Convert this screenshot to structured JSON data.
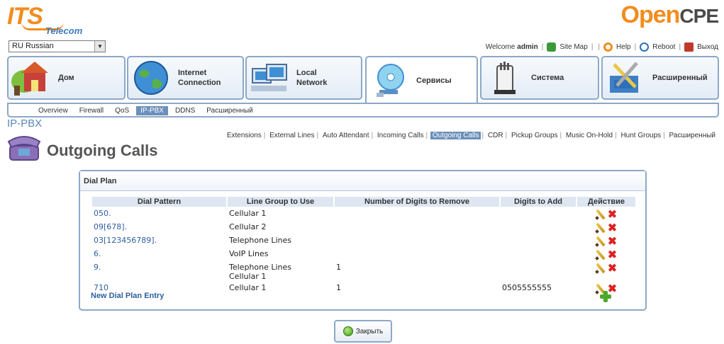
{
  "header": {
    "brand_left_main": "ITS",
    "brand_left_sub": "Telecom",
    "brand_right_open": "Open",
    "brand_right_cpe": "CPE",
    "language": "RU Russian",
    "welcome_text": "Welcome",
    "username": "admin",
    "links": {
      "site_map": "Site Map",
      "help": "Help",
      "reboot": "Reboot",
      "logout": "Выход"
    }
  },
  "main_nav": [
    {
      "label": "Дом",
      "icon": "home-icon"
    },
    {
      "label": "Internet\nConnection",
      "icon": "globe-icon"
    },
    {
      "label": "Local\nNetwork",
      "icon": "computers-icon"
    },
    {
      "label": "Сервисы",
      "icon": "services-disc-icon",
      "active": true
    },
    {
      "label": "Система",
      "icon": "router-icon"
    },
    {
      "label": "Расширенный",
      "icon": "tools-icon"
    }
  ],
  "sub_nav": [
    "Overview",
    "Firewall",
    "QoS",
    "IP-PBX",
    "DDNS",
    "Расширенный"
  ],
  "sub_nav_active": "IP-PBX",
  "breadcrumb": "IP-PBX",
  "page_nav": [
    "Extensions",
    "External Lines",
    "Auto Attendant",
    "Incoming Calls",
    "Outgoing Calls",
    "CDR",
    "Pickup Groups",
    "Music On-Hold",
    "Hunt Groups",
    "Расширенный"
  ],
  "page_nav_active": "Outgoing Calls",
  "page_title": "Outgoing Calls",
  "panel": {
    "title": "Dial Plan",
    "columns": [
      "Dial Pattern",
      "Line Group to Use",
      "Number of Digits to Remove",
      "Digits to Add",
      "Действие"
    ],
    "rows": [
      {
        "pattern": "050.",
        "group": "Cellular 1",
        "remove": "",
        "add": ""
      },
      {
        "pattern": "09[678].",
        "group": "Cellular 2",
        "remove": "",
        "add": ""
      },
      {
        "pattern": "03[123456789].",
        "group": "Telephone Lines",
        "remove": "",
        "add": ""
      },
      {
        "pattern": "6.",
        "group": "VoIP Lines",
        "remove": "",
        "add": ""
      },
      {
        "pattern": "9.",
        "group": "Telephone Lines\nCellular 1",
        "remove": "1",
        "add": ""
      },
      {
        "pattern": "710",
        "group": "Cellular 1",
        "remove": "1",
        "add": "0505555555"
      }
    ],
    "new_entry": "New Dial Plan Entry"
  },
  "close_button": "Закрыть",
  "colors": {
    "accent": "#f28c1e",
    "border": "#8da8c8",
    "link": "#2d5fa0",
    "active_tab": "#6b8fba"
  }
}
